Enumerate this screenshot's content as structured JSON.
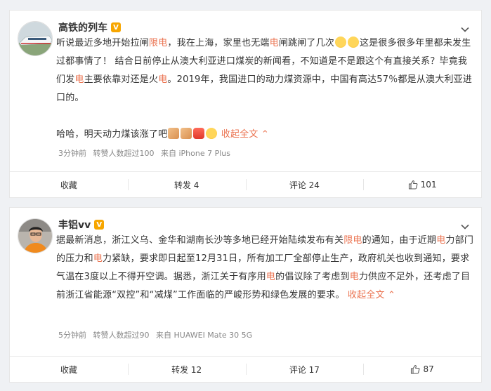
{
  "posts": [
    {
      "author": "高铁的列车",
      "badge": "V",
      "text": {
        "p1": "听说最近多地开始拉闸",
        "h1": "限电",
        "p2": "，我在上海，家里也无端",
        "h2": "电",
        "p3": "闸跳闸了几次",
        "p4": "这是很多很多年里都未发生过都事情了！ 结合日前停止从澳大利亚进口煤炭的新闻看，不知道是不是跟这个有直接关系？毕竟我们发",
        "h3": "电",
        "p5": "主要依靠对还是火",
        "h4": "电",
        "p6": "。2019年，我国进口的动力煤资源中，中国有高达57％都是从澳大利亚进口的。",
        "p7": "哈哈，明天动力煤该涨了吧",
        "expand": "收起全文"
      },
      "meta": {
        "time": "3分钟前",
        "reposts": "转赞人数超过100",
        "source": "来自 iPhone 7 Plus"
      },
      "actions": {
        "collect": "收藏",
        "repost": "转发 4",
        "comment": "评论 24",
        "like": "101"
      }
    },
    {
      "author": "丰铝vv",
      "badge": "V",
      "text": {
        "p1": "据最新消息，浙江义乌、金华和湖南长沙等多地已经开始陆续发布有关",
        "h1": "限电",
        "p2": "的通知，由于近期",
        "h2": "电",
        "p3": "力部门的压力和",
        "h3": "电",
        "p4": "力紧缺，要求即日起至12月31日，所有加工厂全部停止生产，政府机关也收到通知，要求气温在3度以上不得开空调。据悉，浙江关于有序用",
        "h4": "电",
        "p5": "的倡议除了考虑到",
        "h5": "电",
        "p6": "力供应不足外，还考虑了目前浙江省能源“双控”和“减煤”工作面临的严峻形势和绿色发展的要求。",
        "expand": "收起全文"
      },
      "meta": {
        "time": "5分钟前",
        "reposts": "转赞人数超过90",
        "source": "来自 HUAWEI Mate 30 5G"
      },
      "actions": {
        "collect": "收藏",
        "repost": "转发 12",
        "comment": "评论 17",
        "like": "87"
      }
    }
  ],
  "colors": {
    "highlight": "#eb7350",
    "badge": "#f7a600",
    "background": "#eff1f4"
  }
}
